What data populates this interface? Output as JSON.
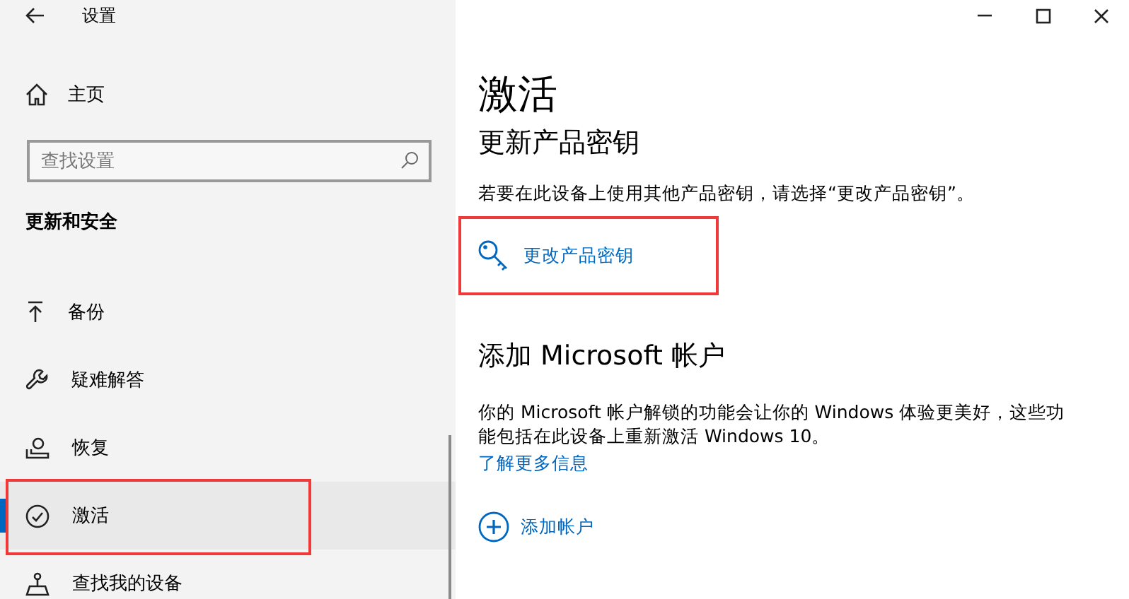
{
  "window": {
    "title": "设置"
  },
  "sidebar": {
    "home": "主页",
    "search": {
      "placeholder": "查找设置"
    },
    "section": "更新和安全",
    "items": [
      {
        "kind": "backup",
        "label": "备份",
        "selected": false,
        "highlighted": false
      },
      {
        "kind": "troubleshoot",
        "label": "疑难解答",
        "selected": false,
        "highlighted": false
      },
      {
        "kind": "recovery",
        "label": "恢复",
        "selected": false,
        "highlighted": false
      },
      {
        "kind": "activation",
        "label": "激活",
        "selected": true,
        "highlighted": true
      },
      {
        "kind": "find-device",
        "label": "查找我的设备",
        "selected": false,
        "highlighted": false
      }
    ]
  },
  "content": {
    "title": "激活",
    "sections": [
      {
        "heading": "更新产品密钥",
        "text": "若要在此设备上使用其他产品密钥，请选择“更改产品密钥”。",
        "action": {
          "kind": "key",
          "label": "更改产品密钥",
          "highlighted": true
        }
      },
      {
        "heading": "添加 Microsoft 帐户",
        "text": "你的 Microsoft 帐户解锁的功能会让你的 Windows 体验更美好，这些功能包括在此设备上重新激活 Windows 10。",
        "link": "了解更多信息",
        "action": {
          "kind": "add",
          "label": "添加帐户",
          "highlighted": false
        }
      }
    ]
  }
}
